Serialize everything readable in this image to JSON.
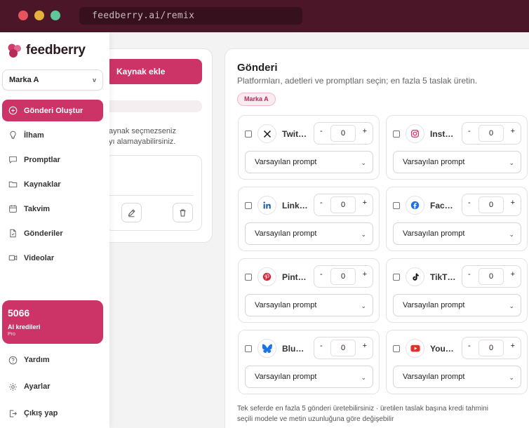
{
  "browser": {
    "url": "feedberry.ai/remix"
  },
  "background_panel": {
    "add_source_label": "Kaynak ekle",
    "hint_line1": "aynak seçmezseniz",
    "hint_line2": "yı alamayabilirsiniz."
  },
  "sidebar": {
    "logo_text": "feedberry",
    "brand_select": "Marka A",
    "nav": [
      {
        "label": "Gönderi Oluştur",
        "icon": "plus-circle-icon",
        "active": true
      },
      {
        "label": "İlham",
        "icon": "lightbulb-icon"
      },
      {
        "label": "Promptlar",
        "icon": "chat-icon"
      },
      {
        "label": "Kaynaklar",
        "icon": "folder-icon"
      },
      {
        "label": "Takvim",
        "icon": "calendar-icon"
      },
      {
        "label": "Gönderiler",
        "icon": "document-icon"
      },
      {
        "label": "Videolar",
        "icon": "video-icon"
      }
    ],
    "credits": {
      "value": "5066",
      "label": "AI kredileri",
      "plan": "Pro"
    },
    "bottom": [
      {
        "label": "Yardım",
        "icon": "help-icon"
      },
      {
        "label": "Ayarlar",
        "icon": "gear-icon"
      },
      {
        "label": "Çıkış yap",
        "icon": "logout-icon"
      }
    ]
  },
  "main": {
    "title": "Gönderi",
    "subtitle": "Platformları, adetleri ve promptları seçin; en fazla 5 taslak üretin.",
    "brand_chip": "Marka A",
    "platforms": [
      {
        "name": "Twit…",
        "count": "0",
        "prompt": "Varsayılan prompt",
        "icon": "x-icon"
      },
      {
        "name": "Inst…",
        "count": "0",
        "prompt": "Varsayılan prompt",
        "icon": "instagram-icon"
      },
      {
        "name": "Link…",
        "count": "0",
        "prompt": "Varsayılan prompt",
        "icon": "linkedin-icon"
      },
      {
        "name": "Fac…",
        "count": "0",
        "prompt": "Varsayılan prompt",
        "icon": "facebook-icon"
      },
      {
        "name": "Pint…",
        "count": "0",
        "prompt": "Varsayılan prompt",
        "icon": "pinterest-icon"
      },
      {
        "name": "TikT…",
        "count": "0",
        "prompt": "Varsayılan prompt",
        "icon": "tiktok-icon"
      },
      {
        "name": "Blu…",
        "count": "0",
        "prompt": "Varsayılan prompt",
        "icon": "bluesky-icon"
      },
      {
        "name": "You…",
        "count": "0",
        "prompt": "Varsayılan prompt",
        "icon": "youtube-icon"
      }
    ],
    "stepper_minus": "-",
    "stepper_plus": "+",
    "footnote_line1": "Tek seferde en fazla 5 gönderi üretebilirsiniz · üretilen taslak başına kredi tahmini",
    "footnote_line2": "seçili modele ve metin uzunluğuna göre değişebilir"
  },
  "colors": {
    "accent": "#cc3467",
    "chrome": "#4b1628"
  }
}
